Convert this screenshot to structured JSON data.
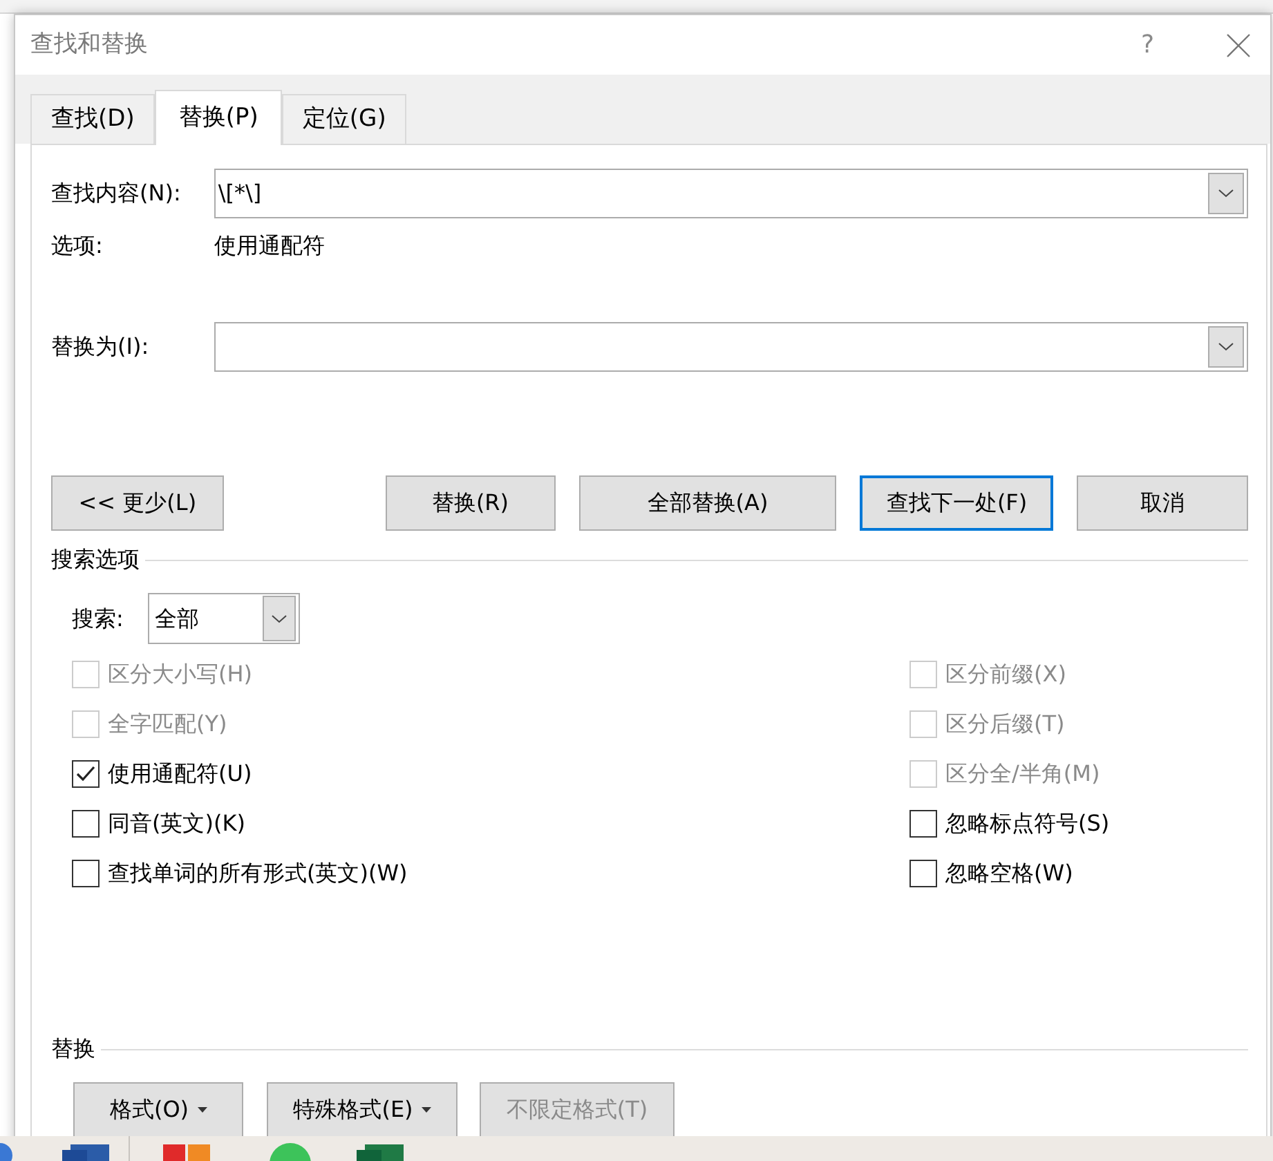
{
  "window": {
    "title": "查找和替换",
    "help": "?"
  },
  "tabs": [
    {
      "label": "查找(D)",
      "selected": false
    },
    {
      "label": "替换(P)",
      "selected": true
    },
    {
      "label": "定位(G)",
      "selected": false
    }
  ],
  "find": {
    "label": "查找内容(N):",
    "value": "\\[*\\]"
  },
  "options": {
    "label": "选项:",
    "value": "使用通配符"
  },
  "replace": {
    "label": "替换为(I):"
  },
  "buttons": [
    {
      "label": "<< 更少(L)",
      "default": false
    },
    {
      "label": "替换(R)",
      "default": false
    },
    {
      "label": "全部替换(A)",
      "default": false
    },
    {
      "label": "查找下一处(F)",
      "default": true
    },
    {
      "label": "取消",
      "default": false
    }
  ],
  "search_options": {
    "title": "搜索选项",
    "search": {
      "label": "搜索:",
      "value": "全部"
    },
    "left": [
      {
        "label": "区分大小写(H)",
        "checked": false,
        "disabled": true
      },
      {
        "label": "全字匹配(Y)",
        "checked": false,
        "disabled": true
      },
      {
        "label": "使用通配符(U)",
        "checked": true,
        "disabled": false
      },
      {
        "label": "同音(英文)(K)",
        "checked": false,
        "disabled": false
      },
      {
        "label": "查找单词的所有形式(英文)(W)",
        "checked": false,
        "disabled": false
      }
    ],
    "right": [
      {
        "label": "区分前缀(X)",
        "checked": false,
        "disabled": true
      },
      {
        "label": "区分后缀(T)",
        "checked": false,
        "disabled": true
      },
      {
        "label": "区分全/半角(M)",
        "checked": false,
        "disabled": true
      },
      {
        "label": "忽略标点符号(S)",
        "checked": false,
        "disabled": false
      },
      {
        "label": "忽略空格(W)",
        "checked": false,
        "disabled": false
      }
    ]
  },
  "replace_section": {
    "title": "替换",
    "buttons": [
      {
        "label": "格式(O)",
        "dropdown": true,
        "disabled": false
      },
      {
        "label": "特殊格式(E)",
        "dropdown": true,
        "disabled": false
      },
      {
        "label": "不限定格式(T)",
        "dropdown": false,
        "disabled": true
      }
    ]
  }
}
